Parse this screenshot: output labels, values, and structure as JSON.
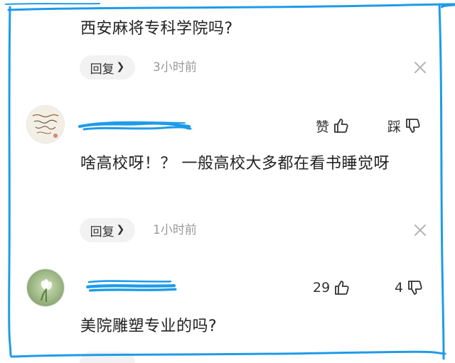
{
  "comments": [
    {
      "text": "西安麻将专科学院吗?",
      "reply_label": "回复",
      "time": "3小时前"
    },
    {
      "avatar_icon": "handwriting-avatar-icon",
      "text": "啥高校呀！？ 一般高校大多都在看书睡觉呀",
      "like_label": "赞",
      "dislike_label": "踩",
      "reply_label": "回复",
      "time": "1小时前"
    },
    {
      "avatar_icon": "flower-avatar-icon",
      "text": "美院雕塑专业的吗?",
      "like_count": "29",
      "dislike_count": "4"
    }
  ],
  "colors": {
    "annotation_blue": "#1e9be8",
    "reply_button_bg": "#f2f2f2",
    "time_text": "#999999"
  }
}
